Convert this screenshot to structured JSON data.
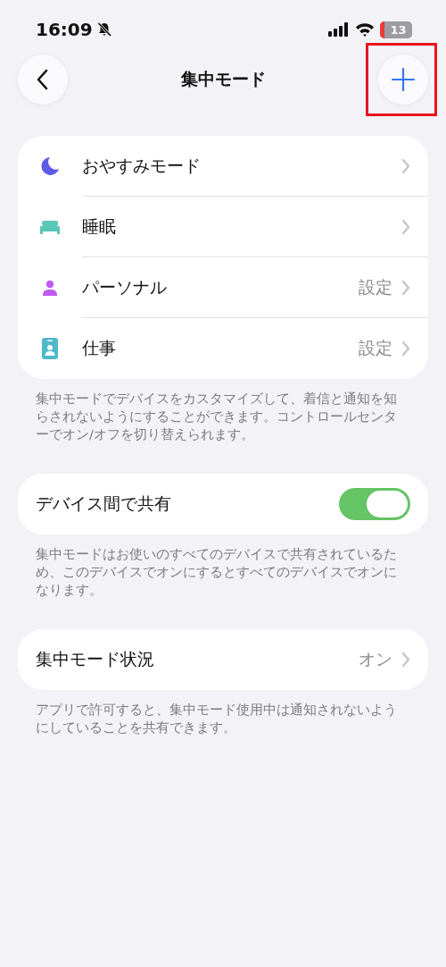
{
  "status_bar": {
    "time": "16:09",
    "silent": true,
    "battery_text": "13"
  },
  "nav": {
    "title": "集中モード",
    "add_button": {
      "highlighted": true
    }
  },
  "modes": [
    {
      "kind": "moon",
      "label": "おやすみモード",
      "color": "#5e5ce6"
    },
    {
      "kind": "bed",
      "label": "睡眠",
      "color": "#5ac8b8"
    },
    {
      "kind": "person",
      "label": "パーソナル",
      "value": "設定",
      "color": "#bf5af2"
    },
    {
      "kind": "badge",
      "label": "仕事",
      "value": "設定",
      "color": "#4fb8c9"
    }
  ],
  "modes_footer": "集中モードでデバイスをカスタマイズして、着信と通知を知らされないようにすることができます。コントロールセンターでオン/オフを切り替えられます。",
  "share": {
    "label": "デバイス間で共有",
    "on": true
  },
  "share_footer": "集中モードはお使いのすべてのデバイスで共有されているため、このデバイスでオンにするとすべてのデバイスでオンになります。",
  "status": {
    "label": "集中モード状況",
    "value": "オン"
  },
  "status_footer": "アプリで許可すると、集中モード使用中は通知されないようにしていることを共有できます。"
}
